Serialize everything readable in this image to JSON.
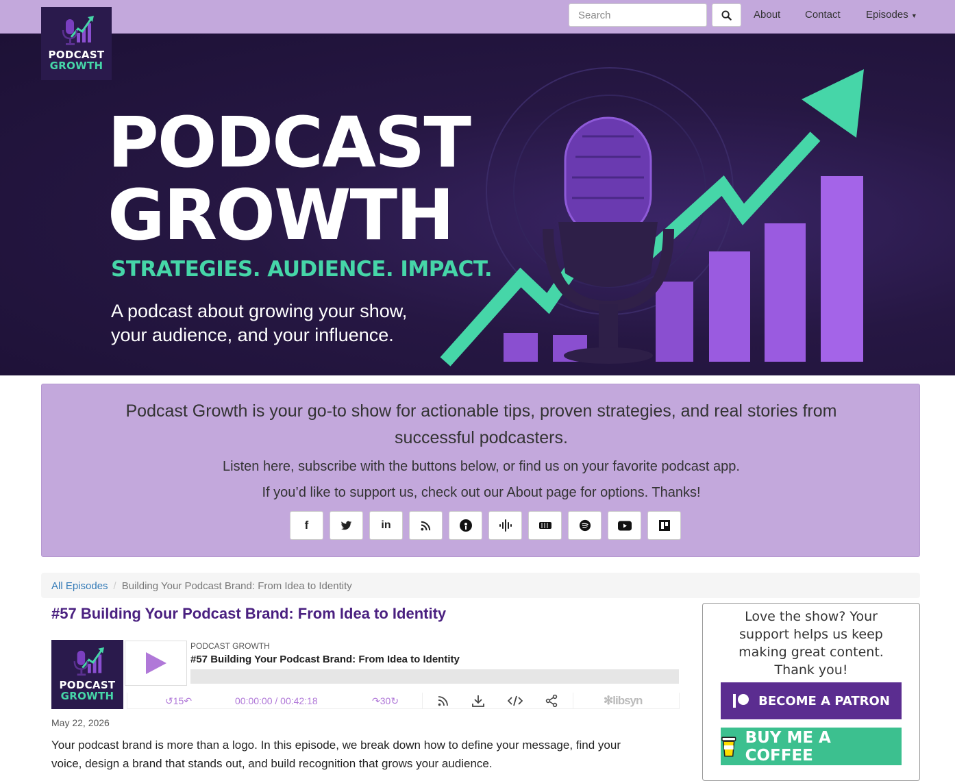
{
  "nav": {
    "search_placeholder": "Search",
    "links": [
      "About",
      "Contact",
      "Episodes"
    ]
  },
  "logo": {
    "line1": "PODCAST",
    "line2": "GROWTH"
  },
  "hero": {
    "title_line1": "PODCAST",
    "title_line2": "GROWTH",
    "tagline": "STRATEGIES. AUDIENCE. IMPACT.",
    "subtitle": "A podcast about growing your show, your audience, and your influence."
  },
  "intro": {
    "lead": "Podcast Growth is your go-to show for actionable tips, proven strategies, and real stories from successful podcasters.",
    "line2": "Listen here, subscribe with the buttons below, or find us on your favorite podcast app.",
    "line3": "If you’d like to support us, check out our About page for options. Thanks!",
    "social_icons": [
      "facebook-icon",
      "twitter-icon",
      "linkedin-icon",
      "rss-icon",
      "apple-podcasts-icon",
      "google-podcasts-icon",
      "stitcher-icon",
      "spotify-icon",
      "youtube-icon",
      "pocket-casts-icon"
    ]
  },
  "breadcrumb": {
    "home": "All Episodes",
    "current": "Building Your Podcast Brand: From Idea to Identity"
  },
  "episode": {
    "title": "#57 Building Your Podcast Brand: From Idea to Identity",
    "date": "May 22, 2026",
    "description": "Your podcast brand is more than a logo. In this episode, we break down how to define your message, find your voice, design a brand that stands out, and build recognition that grows your audience."
  },
  "player": {
    "show": "PODCAST GROWTH",
    "episode": "#57 Building Your Podcast Brand: From Idea to Identity",
    "rewind": "15",
    "forward": "30",
    "time": "00:00:00 / 00:42:18",
    "brand": "libsyn",
    "progress": 0
  },
  "support": {
    "text": "Love the show? Your support helps us keep making great content. Thank you!",
    "patron": "BECOME A PATRON",
    "coffee": "BUY ME A COFFEE"
  },
  "colors": {
    "nav": "#c3a8dc",
    "accent": "#46d6a8",
    "purple": "#4a2080",
    "hero_bg": "#261743"
  }
}
